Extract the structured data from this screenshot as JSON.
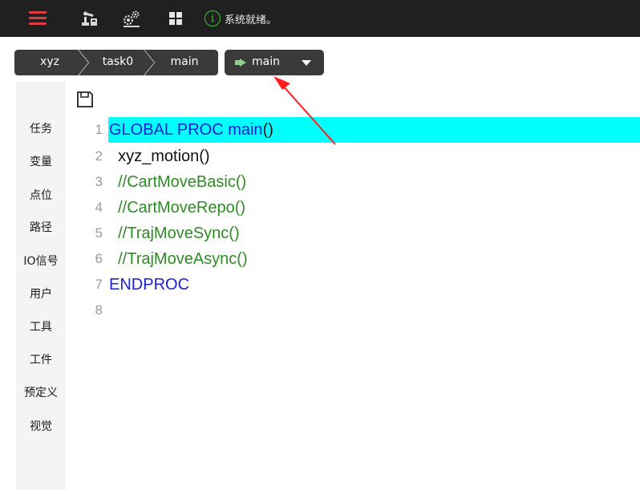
{
  "topbar": {
    "icons": [
      "menu-icon",
      "robot-arm-icon",
      "gears-icon",
      "grid-icon",
      "info-icon"
    ],
    "status_icon_glyph": "i",
    "status_text": "系统就绪。",
    "status_color": "#36c43a",
    "menu_color": "#e0393e"
  },
  "breadcrumb": {
    "items": [
      "xyz",
      "task0",
      "main"
    ],
    "run_label": "main"
  },
  "sidebar": {
    "items": [
      "任务",
      "变量",
      "点位",
      "路径",
      "IO信号",
      "用户",
      "工具",
      "工件",
      "预定义",
      "视觉"
    ]
  },
  "editor": {
    "highlight_color": "#00ffff",
    "lines": [
      {
        "num": "1",
        "segments": [
          {
            "text": "GLOBAL PROC ",
            "style": "kw"
          },
          {
            "text": "main",
            "style": "kw"
          },
          {
            "text": "()",
            "style": "ident"
          }
        ]
      },
      {
        "num": "2",
        "segments": [
          {
            "text": "  xyz_motion()",
            "style": "ident"
          }
        ]
      },
      {
        "num": "3",
        "segments": [
          {
            "text": "  //CartMoveBasic()",
            "style": "cmt"
          }
        ]
      },
      {
        "num": "4",
        "segments": [
          {
            "text": "  //CartMoveRepo()",
            "style": "cmt"
          }
        ]
      },
      {
        "num": "5",
        "segments": [
          {
            "text": "  //TrajMoveSync()",
            "style": "cmt"
          }
        ]
      },
      {
        "num": "6",
        "segments": [
          {
            "text": "  //TrajMoveAsync()",
            "style": "cmt"
          }
        ]
      },
      {
        "num": "7",
        "segments": [
          {
            "text": "ENDPROC",
            "style": "kw"
          }
        ]
      },
      {
        "num": "8",
        "segments": []
      }
    ]
  }
}
